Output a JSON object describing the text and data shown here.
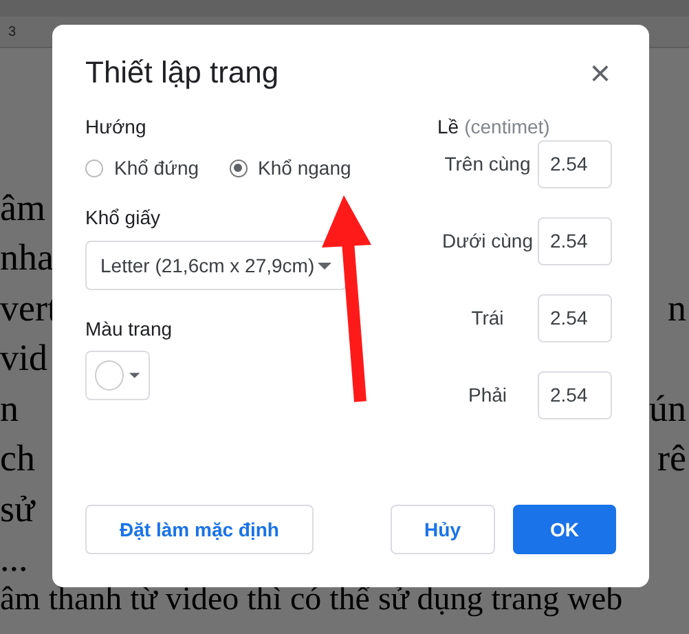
{
  "ruler": {
    "marker": "3"
  },
  "document_rows": [
    {
      "left": "âm"
    },
    {
      "left": "nha"
    },
    {
      "left": "vert",
      "right": "n"
    },
    {
      "left": "vid"
    },
    {
      "left": "n",
      "right": "ún"
    },
    {
      "left": "ch",
      "right": "rê"
    },
    {
      "left": "sử"
    },
    {
      "left": "..."
    }
  ],
  "document_last_line": "âm thanh từ video thì có thể sử dụng trang web",
  "dialog": {
    "title": "Thiết lập trang",
    "close": "×",
    "orientation": {
      "label": "Hướng",
      "options": [
        {
          "label": "Khổ đứng",
          "selected": false
        },
        {
          "label": "Khổ ngang",
          "selected": true
        }
      ]
    },
    "paper_size": {
      "label": "Khổ giấy",
      "value": "Letter (21,6cm x 27,9cm)"
    },
    "page_color": {
      "label": "Màu trang",
      "color": "#ffffff"
    },
    "margins": {
      "label": "Lề",
      "unit": "(centimet)",
      "fields": [
        {
          "label": "Trên cùng",
          "value": "2.54"
        },
        {
          "label": "Dưới cùng",
          "value": "2.54"
        },
        {
          "label": "Trái",
          "value": "2.54"
        },
        {
          "label": "Phải",
          "value": "2.54"
        }
      ]
    },
    "buttons": [
      {
        "label": "Đặt làm mặc định",
        "kind": "secondary"
      },
      {
        "label": "Hủy",
        "kind": "secondary"
      },
      {
        "label": "OK",
        "kind": "primary"
      }
    ]
  },
  "annotation": {
    "kind": "arrow"
  }
}
